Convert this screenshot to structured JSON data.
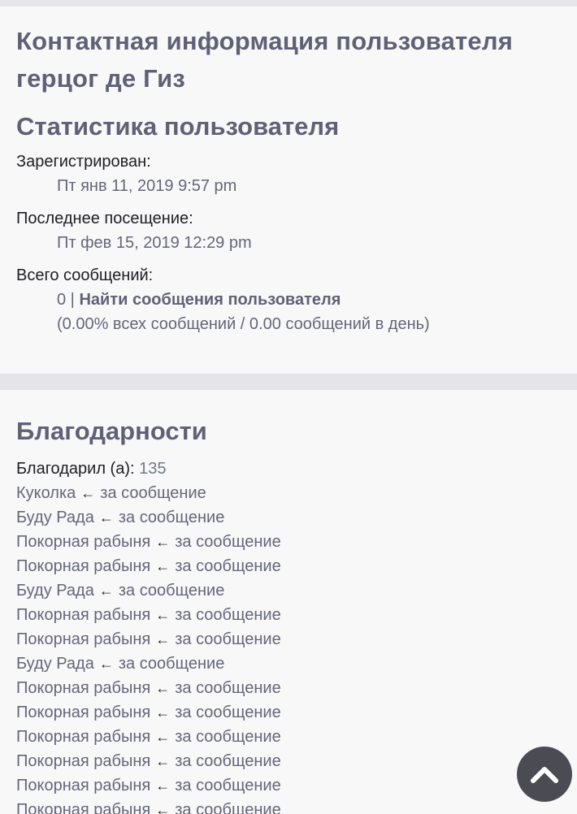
{
  "profile": {
    "title": "Контактная информация пользователя герцог де Гиз",
    "stats_heading": "Статистика пользователя",
    "registered_label": "Зарегистрирован:",
    "registered_value": "Пт янв 11, 2019 9:57 pm",
    "last_visit_label": "Последнее посещение:",
    "last_visit_value": "Пт фев 15, 2019 12:29 pm",
    "posts_label": "Всего сообщений:",
    "posts_count": "0 |",
    "find_posts_link": "Найти сообщения пользователя",
    "posts_stats": "(0.00% всех сообщений / 0.00 сообщений в день)"
  },
  "thanks": {
    "heading": "Благодарности",
    "gave_label": "Благодарил (а):",
    "gave_count": "135",
    "arrow": "←",
    "suffix": "за сообщение",
    "items": [
      {
        "user": "Куколка"
      },
      {
        "user": "Буду Рада"
      },
      {
        "user": "Покорная рабыня"
      },
      {
        "user": "Покорная рабыня"
      },
      {
        "user": "Буду Рада"
      },
      {
        "user": "Покорная рабыня"
      },
      {
        "user": "Покорная рабыня"
      },
      {
        "user": "Буду Рада"
      },
      {
        "user": "Покорная рабыня"
      },
      {
        "user": "Покорная рабыня"
      },
      {
        "user": "Покорная рабыня"
      },
      {
        "user": "Покорная рабыня"
      },
      {
        "user": "Покорная рабыня"
      },
      {
        "user": "Покорная рабыня"
      }
    ]
  },
  "scroll_top": {
    "icon": "chevron-up-icon",
    "color": "#4b4b54"
  }
}
